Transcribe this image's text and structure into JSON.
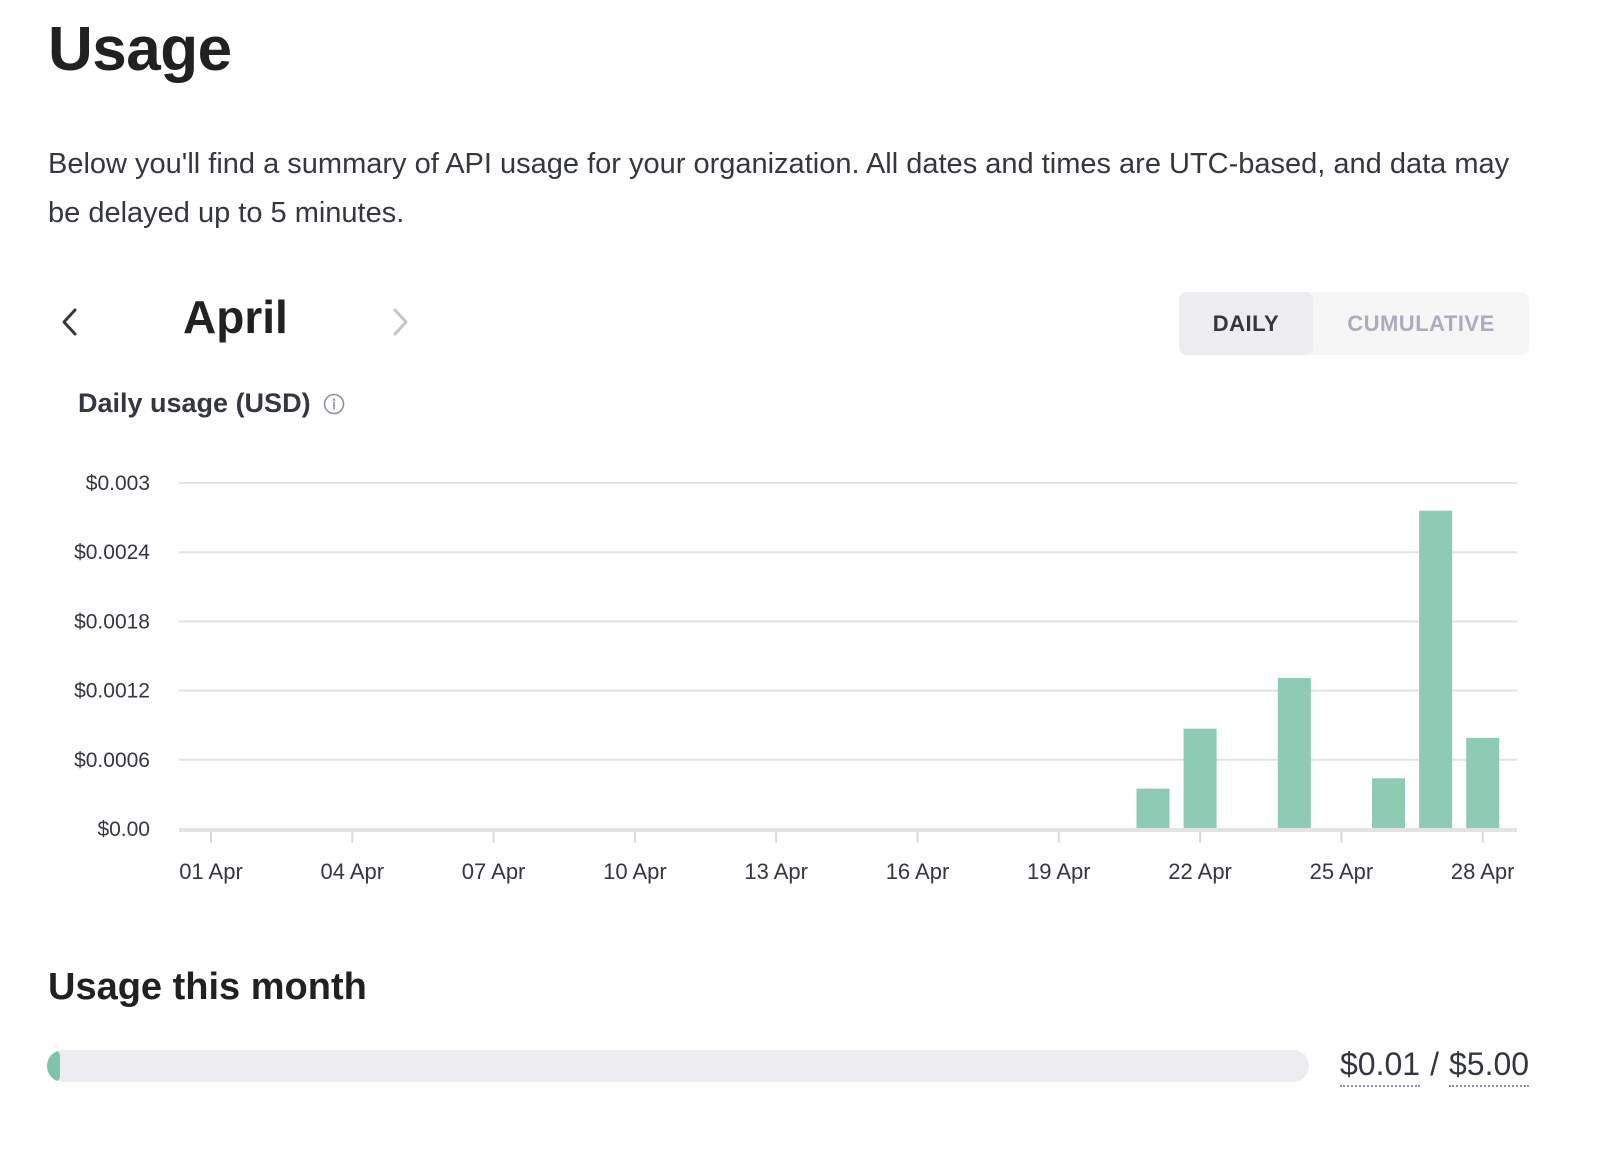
{
  "page": {
    "title": "Usage",
    "description": "Below you'll find a summary of API usage for your organization. All dates and times are UTC-based, and data may be delayed up to 5 minutes."
  },
  "month_nav": {
    "prev_icon": "chevron-left-icon",
    "current_month": "April",
    "next_icon": "chevron-right-icon"
  },
  "view_toggle": {
    "options": [
      "DAILY",
      "CUMULATIVE"
    ],
    "selected": "DAILY"
  },
  "chart_section": {
    "title": "Daily usage (USD)",
    "info_icon": "info-icon"
  },
  "chart_data": {
    "type": "bar",
    "title": "Daily usage (USD)",
    "xlabel": "",
    "ylabel": "",
    "ylim": [
      0,
      0.003
    ],
    "y_ticks": [
      0,
      0.0006,
      0.0012,
      0.0018,
      0.0024,
      0.003
    ],
    "y_tick_labels": [
      "$0.00",
      "$0.0006",
      "$0.0012",
      "$0.0018",
      "$0.0024",
      "$0.003"
    ],
    "x_tick_labels": [
      "01 Apr",
      "04 Apr",
      "07 Apr",
      "10 Apr",
      "13 Apr",
      "16 Apr",
      "19 Apr",
      "22 Apr",
      "25 Apr",
      "28 Apr"
    ],
    "x_tick_days": [
      1,
      4,
      7,
      10,
      13,
      16,
      19,
      22,
      25,
      28
    ],
    "x_range_days": [
      1,
      28
    ],
    "grid": true,
    "bar_color": "#8ecbb5",
    "categories": [
      "01 Apr",
      "02 Apr",
      "03 Apr",
      "04 Apr",
      "05 Apr",
      "06 Apr",
      "07 Apr",
      "08 Apr",
      "09 Apr",
      "10 Apr",
      "11 Apr",
      "12 Apr",
      "13 Apr",
      "14 Apr",
      "15 Apr",
      "16 Apr",
      "17 Apr",
      "18 Apr",
      "19 Apr",
      "20 Apr",
      "21 Apr",
      "22 Apr",
      "23 Apr",
      "24 Apr",
      "25 Apr",
      "26 Apr",
      "27 Apr",
      "28 Apr"
    ],
    "values": [
      0,
      0,
      0,
      0,
      0,
      0,
      0,
      0,
      0,
      0,
      0,
      0,
      0,
      0,
      0,
      0,
      0,
      0,
      0,
      0,
      0.00035,
      0.00087,
      0,
      0.00131,
      0,
      0.00044,
      0.00276,
      0.00079
    ]
  },
  "usage_this_month": {
    "title": "Usage this month",
    "used": "$0.01",
    "separator": "/",
    "limit": "$5.00",
    "fraction": 0.002,
    "fill_color": "#7fc4aa"
  }
}
